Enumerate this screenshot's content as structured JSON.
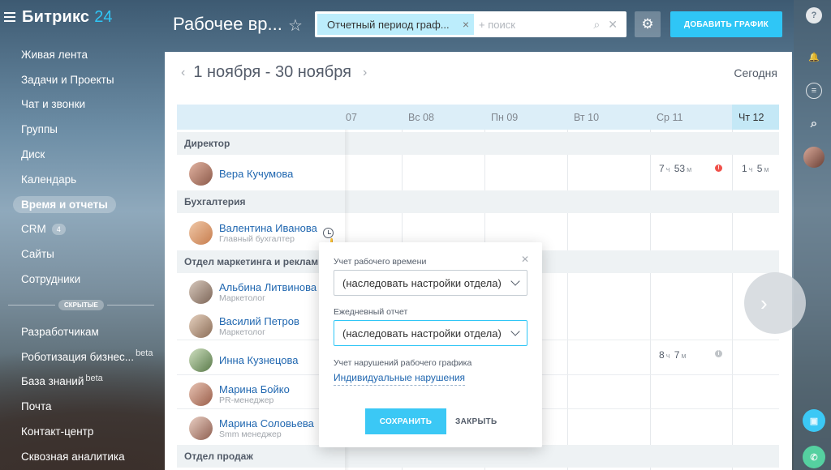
{
  "app": {
    "brand": "Битрикс",
    "brand_num": "24"
  },
  "menu": {
    "items": [
      {
        "label": "Живая лента"
      },
      {
        "label": "Задачи и Проекты"
      },
      {
        "label": "Чат и звонки"
      },
      {
        "label": "Группы"
      },
      {
        "label": "Диск"
      },
      {
        "label": "Календарь"
      },
      {
        "label": "Время и отчеты",
        "active": true
      },
      {
        "label": "CRM",
        "count": "4"
      },
      {
        "label": "Сайты"
      },
      {
        "label": "Сотрудники"
      }
    ],
    "hidden_label": "СКРЫТЫЕ",
    "hidden_items": [
      {
        "label": "Разработчикам"
      },
      {
        "label": "Роботизация бизнес...",
        "badge": "beta"
      },
      {
        "label": "База знаний",
        "badge": "beta"
      },
      {
        "label": "Почта"
      },
      {
        "label": "Контакт-центр"
      },
      {
        "label": "Сквозная аналитика"
      }
    ]
  },
  "header": {
    "title": "Рабочее вр...",
    "filter_chip": "Отчетный период граф...",
    "search_placeholder": "+ поиск",
    "add_button": "ДОБАВИТЬ ГРАФИК"
  },
  "calendar": {
    "period": "1 ноября - 30 ноября",
    "today": "Сегодня",
    "days": [
      "07",
      "Вс 08",
      "Пн 09",
      "Вт 10",
      "Ср 11",
      "Чт 12"
    ],
    "groups": [
      {
        "name": "Директор"
      },
      {
        "name": "Бухгалтерия"
      },
      {
        "name": "Отдел маркетинга и рекламы"
      },
      {
        "name": "Отдел продаж"
      }
    ],
    "employees": [
      {
        "name": "Вера Кучумова",
        "position": ""
      },
      {
        "name": "Валентина Иванова",
        "position": "Главный бухгалтер"
      },
      {
        "name": "Альбина Литвинова",
        "position": "Маркетолог"
      },
      {
        "name": "Василий Петров",
        "position": "Маркетолог"
      },
      {
        "name": "Инна Кузнецова",
        "position": ""
      },
      {
        "name": "Марина Бойко",
        "position": "PR-менеджер"
      },
      {
        "name": "Марина Соловьева",
        "position": "Smm менеджер"
      }
    ],
    "times": {
      "vera_wed": {
        "h": "7",
        "hu": "ч",
        "m": "53",
        "mu": "м"
      },
      "vera_thu": {
        "h": "1",
        "hu": "ч",
        "m": "5",
        "mu": "м"
      },
      "inna_wed": {
        "h": "8",
        "hu": "ч",
        "m": "7",
        "mu": "м"
      }
    }
  },
  "popup": {
    "label1": "Учет рабочего времени",
    "select1": "(наследовать настройки отдела)",
    "label2": "Ежедневный отчет",
    "select2": "(наследовать настройки отдела)",
    "label3": "Учет нарушений рабочего графика",
    "link": "Индивидуальные нарушения",
    "save": "СОХРАНИТЬ",
    "close": "ЗАКРЫТЬ"
  },
  "colors": {
    "accent": "#2fc6f6",
    "link": "#2067b0",
    "warning": "#f0514a"
  },
  "icons": [
    "menu-icon",
    "star-icon",
    "search-icon",
    "gear-icon",
    "help-icon",
    "bell-icon",
    "chat-icon",
    "clock-icon",
    "chevron-left-icon",
    "chevron-right-icon",
    "phone-icon"
  ]
}
